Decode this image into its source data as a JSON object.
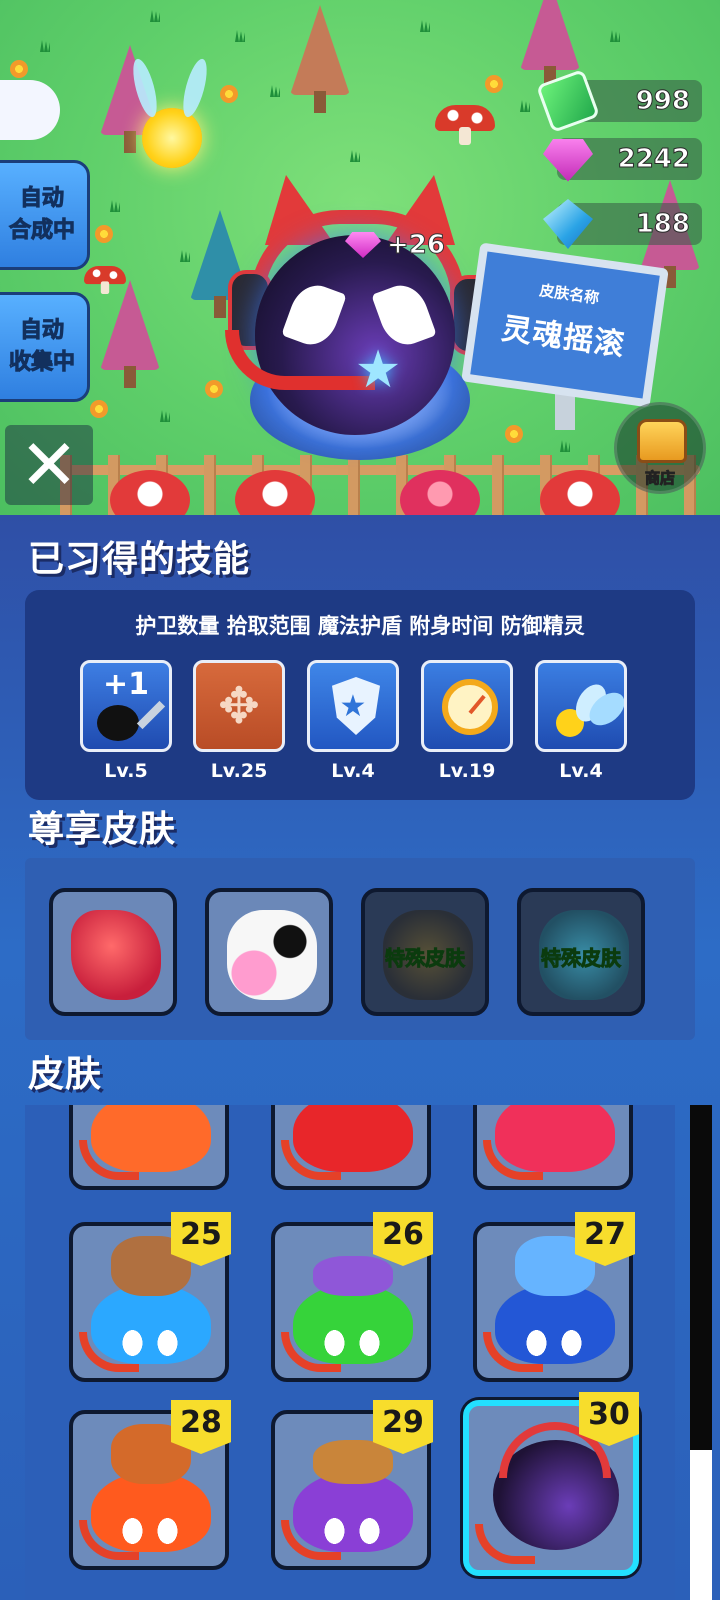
{
  "currency": {
    "cash": {
      "value": "998",
      "icon": "cash-icon",
      "color": "#2fcf5a"
    },
    "gems": {
      "value": "2242",
      "icon": "pink-gem-icon",
      "color": "#e23ad0"
    },
    "crystals": {
      "value": "188",
      "icon": "blue-crystal-icon",
      "color": "#2aa3e6"
    }
  },
  "side_buttons": {
    "auto_merge": [
      "自动",
      "合成中"
    ],
    "auto_collect": [
      "自动",
      "收集中"
    ],
    "close_icon": "close-icon"
  },
  "scene": {
    "gain_text": "+26",
    "sign_sub": "皮肤名称",
    "sign_main": "灵魂摇滚",
    "shop_label": "商店"
  },
  "skills": {
    "title": "已习得的技能",
    "names_line": "护卫数量 拾取范围 魔法护盾 附身时间 防御精灵",
    "items": [
      {
        "icon": "guard-count-icon",
        "badge": "+1",
        "level": "Lv.5"
      },
      {
        "icon": "pickup-range-icon",
        "level": "Lv.25"
      },
      {
        "icon": "magic-shield-icon",
        "level": "Lv.4"
      },
      {
        "icon": "stopwatch-icon",
        "level": "Lv.19"
      },
      {
        "icon": "guardian-spirit-icon",
        "level": "Lv.4"
      }
    ]
  },
  "premium": {
    "title": "尊享皮肤",
    "items": [
      {
        "icon": "red-dragon-icon",
        "special": ""
      },
      {
        "icon": "cow-icon",
        "special": ""
      },
      {
        "icon": "bee-bot-icon",
        "special": "特殊皮肤"
      },
      {
        "icon": "blue-octopus-icon",
        "special": "特殊皮肤"
      }
    ]
  },
  "skins": {
    "title": "皮肤",
    "partial_row": [
      {
        "color": "#ff6a2a"
      },
      {
        "color": "#e8262a"
      },
      {
        "color": "#f0305a"
      }
    ],
    "rows": [
      {
        "level": "25",
        "color": "#2ba8ff",
        "hat": "#b07040",
        "icon": "beaver-hat-icon"
      },
      {
        "level": "26",
        "color": "#36d33a",
        "hat": "#8f57d8",
        "icon": "ufo-alien-icon"
      },
      {
        "level": "27",
        "color": "#2357d6",
        "hat": "#66b4ff",
        "icon": "shark-icon"
      },
      {
        "level": "28",
        "color": "#ff5a1e",
        "hat": "#d46a2a",
        "icon": "viking-helmet-icon"
      },
      {
        "level": "29",
        "color": "#8a3fd6",
        "hat": "#c9853a",
        "icon": "burger-icon"
      },
      {
        "level": "30",
        "color": "#3a1f63",
        "hat": "#e23a3a",
        "icon": "soul-rock-icon",
        "selected": true
      }
    ]
  }
}
